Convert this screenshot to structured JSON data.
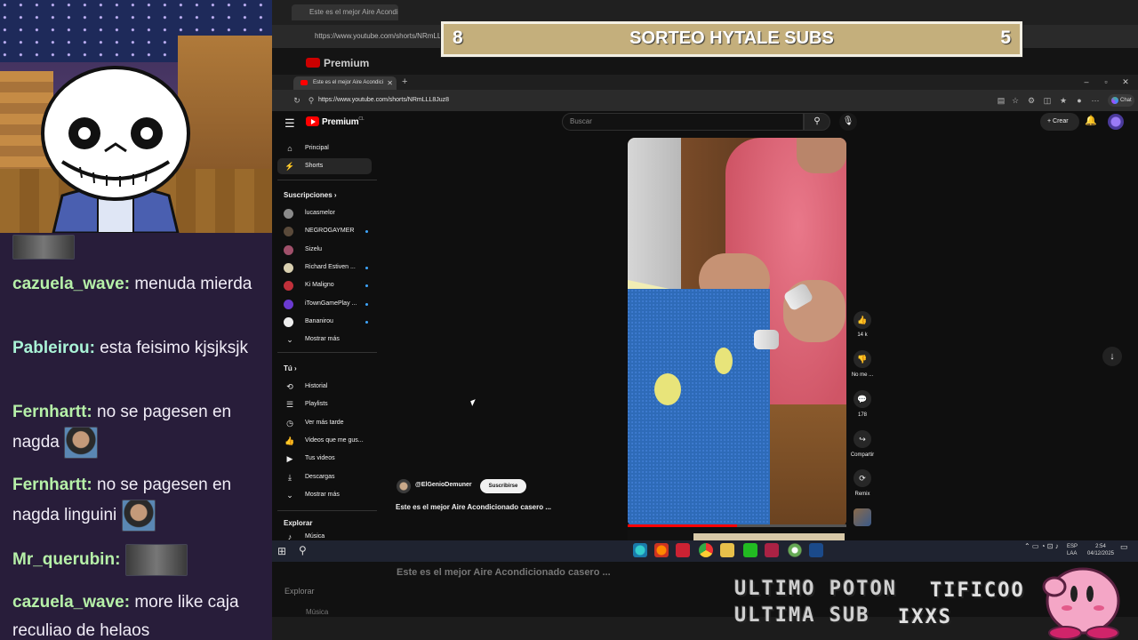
{
  "stream": {
    "chat": [
      {
        "user": "cazuela_wave",
        "text": "menuda mierda"
      },
      {
        "user": "Pableirou",
        "text": "esta feisimo kjsjksjk"
      },
      {
        "user": "Fernhartt",
        "text": "no se pagesen en nagda"
      },
      {
        "user": "Fernhartt",
        "text": "no se pagesen en nagda linguini"
      },
      {
        "user": "Mr_querubin",
        "text": ""
      },
      {
        "user": "cazuela_wave",
        "text": "more like caja reculiao de helaos"
      }
    ],
    "overlay": {
      "left_number": "8",
      "title": "SORTEO HYTALE SUBS",
      "right_number": "5",
      "bottom_line1": "ULTIMO POTON",
      "bottom_tag": "TIFICOO",
      "bottom_line2": "ULTIMA SUB",
      "bottom_tag2": "IXXS"
    }
  },
  "browser": {
    "tab_title": "Este es el mejor Aire Acondici",
    "ghost_tab_title": "Este es el mejor Aire Acondi",
    "url": "https://www.youtube.com/shorts/NRmLLL8Juz8",
    "ghost_url": "https://www.youtube.com/shorts/NRmLLL8",
    "chat_label": "Chat"
  },
  "youtube": {
    "brand": "Premium",
    "brand_country": "CL",
    "search_placeholder": "Buscar",
    "create_label": "Crear",
    "sidebar": {
      "home": "Principal",
      "shorts": "Shorts",
      "subs_header": "Suscripciones",
      "channels": [
        {
          "name": "lucasmelor",
          "color": "#8a8a8a",
          "dot": false
        },
        {
          "name": "NEGROGAYMER",
          "color": "#5a4a3a",
          "dot": true
        },
        {
          "name": "Sizelu",
          "color": "#a0506a",
          "dot": false
        },
        {
          "name": "Richard Estiven ...",
          "color": "#d9d0b0",
          "dot": true
        },
        {
          "name": "Ki Maligno",
          "color": "#c0303a",
          "dot": true
        },
        {
          "name": "iTownGamePlay ...",
          "color": "#6a3ad0",
          "dot": true
        },
        {
          "name": "Bananirou",
          "color": "#eeeeee",
          "dot": true
        }
      ],
      "show_more": "Mostrar más",
      "you_header": "Tú",
      "you_items": [
        {
          "label": "Historial",
          "icon": "history-icon",
          "glyph": "⟲"
        },
        {
          "label": "Playlists",
          "icon": "playlists-icon",
          "glyph": "☰"
        },
        {
          "label": "Ver más tarde",
          "icon": "clock-icon",
          "glyph": "◷"
        },
        {
          "label": "Videos que me gus...",
          "icon": "thumbs-up-icon",
          "glyph": "👍"
        },
        {
          "label": "Tus videos",
          "icon": "your-videos-icon",
          "glyph": "▶"
        },
        {
          "label": "Descargas",
          "icon": "download-icon",
          "glyph": "⤓"
        },
        {
          "label": "Mostrar más",
          "icon": "chevron-down-icon",
          "glyph": "⌄"
        }
      ],
      "explore_header": "Explorar",
      "music": "Música"
    },
    "short": {
      "channel": "@ElGenioDemuner",
      "subscribe": "Suscribirse",
      "title": "Este es el mejor Aire Acondicionado casero ...",
      "likes": "14 k",
      "dislike_label": "No me ...",
      "comments": "178",
      "share": "Compartir",
      "remix": "Remix"
    }
  },
  "taskbar": {
    "lang": "ESP",
    "layout": "LAA",
    "time": "2:54",
    "date": "04/12/2025"
  }
}
